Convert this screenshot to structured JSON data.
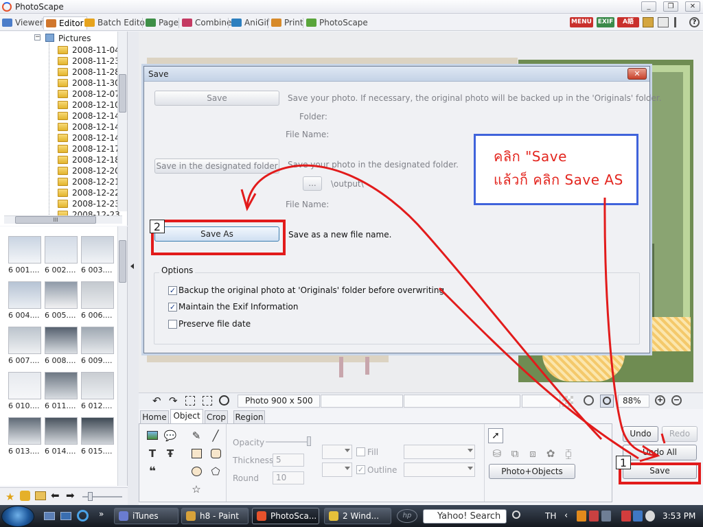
{
  "window": {
    "title": "PhotoScape",
    "controls": [
      "_",
      "❐",
      "✕"
    ]
  },
  "menu": {
    "tabs": [
      {
        "label": "Viewer",
        "color": "#4c7dc9"
      },
      {
        "label": "Editor",
        "color": "#d0762c"
      },
      {
        "label": "Batch Editor",
        "color": "#e6a31c"
      },
      {
        "label": "Page",
        "color": "#3e8f47"
      },
      {
        "label": "Combine",
        "color": "#c43a63"
      },
      {
        "label": "AniGif",
        "color": "#2d7fbf"
      },
      {
        "label": "Print",
        "color": "#d78a2a"
      },
      {
        "label": "PhotoScape",
        "color": "#5aa53b"
      }
    ],
    "right_tools": [
      "MENU",
      "EXIF",
      "A語"
    ]
  },
  "tree": {
    "root_label": "Pictures",
    "folders": [
      "2008-11-04",
      "2008-11-23",
      "2008-11-28",
      "2008-11-30",
      "2008-12-07",
      "2008-12-10",
      "2008-12-14",
      "2008-12-14",
      "2008-12-14",
      "2008-12-17",
      "2008-12-18",
      "2008-12-20",
      "2008-12-21",
      "2008-12-22",
      "2008-12-23",
      "2008-12-23"
    ],
    "hscroll_grip": "III"
  },
  "thumbnails": {
    "captions": [
      "6 001....",
      "6 002....",
      "6 003....",
      "6 004....",
      "6 005....",
      "6 006....",
      "6 007....",
      "6 008....",
      "6 009....",
      "6 010....",
      "6 011....",
      "6 012....",
      "6 013....",
      "6 014....",
      "6 015...."
    ]
  },
  "status": {
    "photo_info": "Photo 900 x 500",
    "zoom": "88%"
  },
  "object_panel": {
    "tabs": [
      "Home",
      "Object",
      "Crop",
      "Region"
    ],
    "active_tab": "Object",
    "opacity_label": "Opacity",
    "thickness_label": "Thickness",
    "thickness_value": "5",
    "round_label": "Round",
    "round_value": "10",
    "fill_label": "Fill",
    "outline_label": "Outline",
    "photo_objects_button": "Photo+Objects"
  },
  "right_buttons": {
    "undo": "Undo",
    "redo": "Redo",
    "undo_all": "Undo All",
    "save": "Save"
  },
  "dialog": {
    "title": "Save",
    "save_button": "Save",
    "save_desc": "Save your photo. If necessary, the original photo will be backed up in the 'Originals' folder.",
    "folder_label": "Folder:",
    "file_name_label": "File Name:",
    "save_folder_button": "Save in the designated folder",
    "save_folder_desc": "Save your photo in the designated folder.",
    "browse_button": "...",
    "output_path": "\\output\\",
    "file_name_label2": "File Name:",
    "save_as_button": "Save As",
    "save_as_desc": "Save as a new file name.",
    "options_title": "Options",
    "options": [
      {
        "label": "Backup the original photo at 'Originals' folder before overwriting",
        "checked": true
      },
      {
        "label": "Maintain the Exif Information",
        "checked": true
      },
      {
        "label": "Preserve file date",
        "checked": false
      }
    ]
  },
  "annotation": {
    "line1": "คลิก \"Save",
    "line2": "แล้วก็ คลิก Save AS",
    "step1": "1",
    "step2": "2"
  },
  "taskbar": {
    "items": [
      {
        "label": "iTunes",
        "color": "#6a7ccf"
      },
      {
        "label": "h8 - Paint",
        "color": "#d8a23a"
      },
      {
        "label": "PhotoSca...",
        "color": "#e6522c"
      },
      {
        "label": "2 Wind...",
        "color": "#e6c03a"
      }
    ],
    "search_placeholder": "Yahoo! Search",
    "language": "TH",
    "clock": "3:53 PM"
  }
}
